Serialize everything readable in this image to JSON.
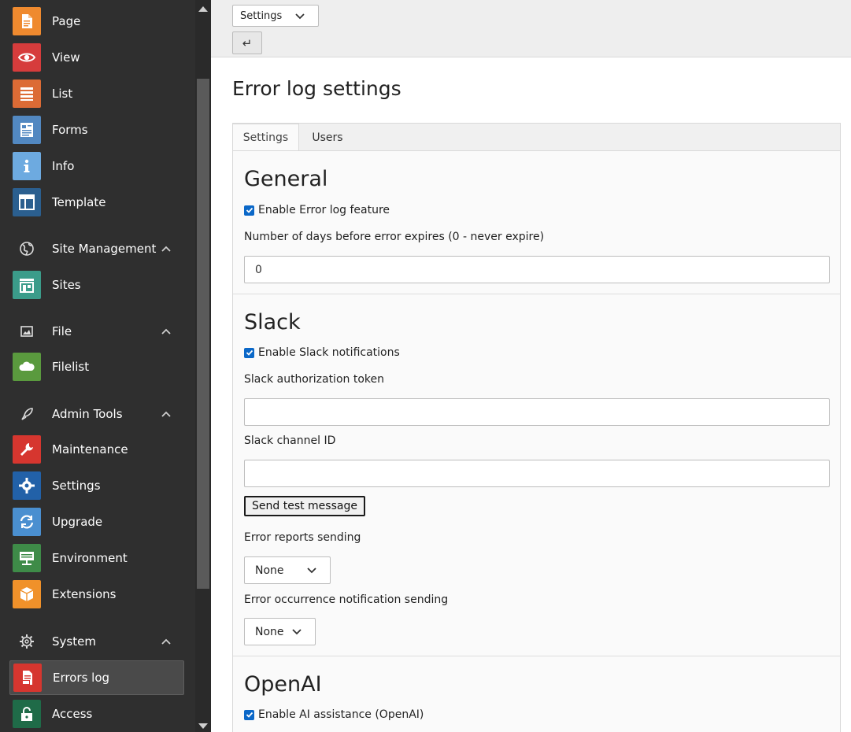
{
  "sidebar": {
    "top_items": [
      {
        "label": "Page",
        "icon": "page-icon",
        "color": "#ef8a2f"
      },
      {
        "label": "View",
        "icon": "eye-icon",
        "color": "#d63c3c"
      },
      {
        "label": "List",
        "icon": "list-icon",
        "color": "#dc6b35"
      },
      {
        "label": "Forms",
        "icon": "forms-icon",
        "color": "#5288c1"
      },
      {
        "label": "Info",
        "icon": "info-icon",
        "color": "#6daae0"
      },
      {
        "label": "Template",
        "icon": "template-icon",
        "color": "#2b5f8f"
      }
    ],
    "groups": [
      {
        "label": "Site Management",
        "icon": "globe-icon",
        "items": [
          {
            "label": "Sites",
            "icon": "sites-icon",
            "color": "#3b9c8a"
          }
        ]
      },
      {
        "label": "File",
        "icon": "image-icon",
        "items": [
          {
            "label": "Filelist",
            "icon": "cloud-icon",
            "color": "#5a9a3e"
          }
        ]
      },
      {
        "label": "Admin Tools",
        "icon": "rocket-icon",
        "items": [
          {
            "label": "Maintenance",
            "icon": "wrench-icon",
            "color": "#d6362f"
          },
          {
            "label": "Settings",
            "icon": "gear-icon",
            "color": "#2261a8"
          },
          {
            "label": "Upgrade",
            "icon": "refresh-icon",
            "color": "#4a8fd0"
          },
          {
            "label": "Environment",
            "icon": "environment-icon",
            "color": "#3e8b48"
          },
          {
            "label": "Extensions",
            "icon": "box-icon",
            "color": "#f0912a"
          }
        ]
      },
      {
        "label": "System",
        "icon": "cog-icon",
        "items": [
          {
            "label": "Errors log",
            "icon": "errors-log-icon",
            "color": "#d6362f"
          },
          {
            "label": "Access",
            "icon": "lock-icon",
            "color": "#1f6b48"
          }
        ]
      }
    ]
  },
  "toolbar": {
    "view_select": "Settings",
    "back_symbol": "↵"
  },
  "main": {
    "title": "Error log settings",
    "tabs": [
      {
        "label": "Settings"
      },
      {
        "label": "Users"
      }
    ],
    "general": {
      "title": "General",
      "enable_label": "Enable Error log feature",
      "days_label": "Number of days before error expires (0 - never expire)",
      "days_value": "0"
    },
    "slack": {
      "title": "Slack",
      "enable_label": "Enable Slack notifications",
      "token_label": "Slack authorization token",
      "token_value": "",
      "channel_label": "Slack channel ID",
      "channel_value": "",
      "test_button": "Send test message",
      "reports_label": "Error reports sending",
      "reports_value": "None",
      "occurrence_label": "Error occurrence notification sending",
      "occurrence_value": "None"
    },
    "openai": {
      "title": "OpenAI",
      "enable_label": "Enable AI assistance (OpenAI)"
    }
  }
}
